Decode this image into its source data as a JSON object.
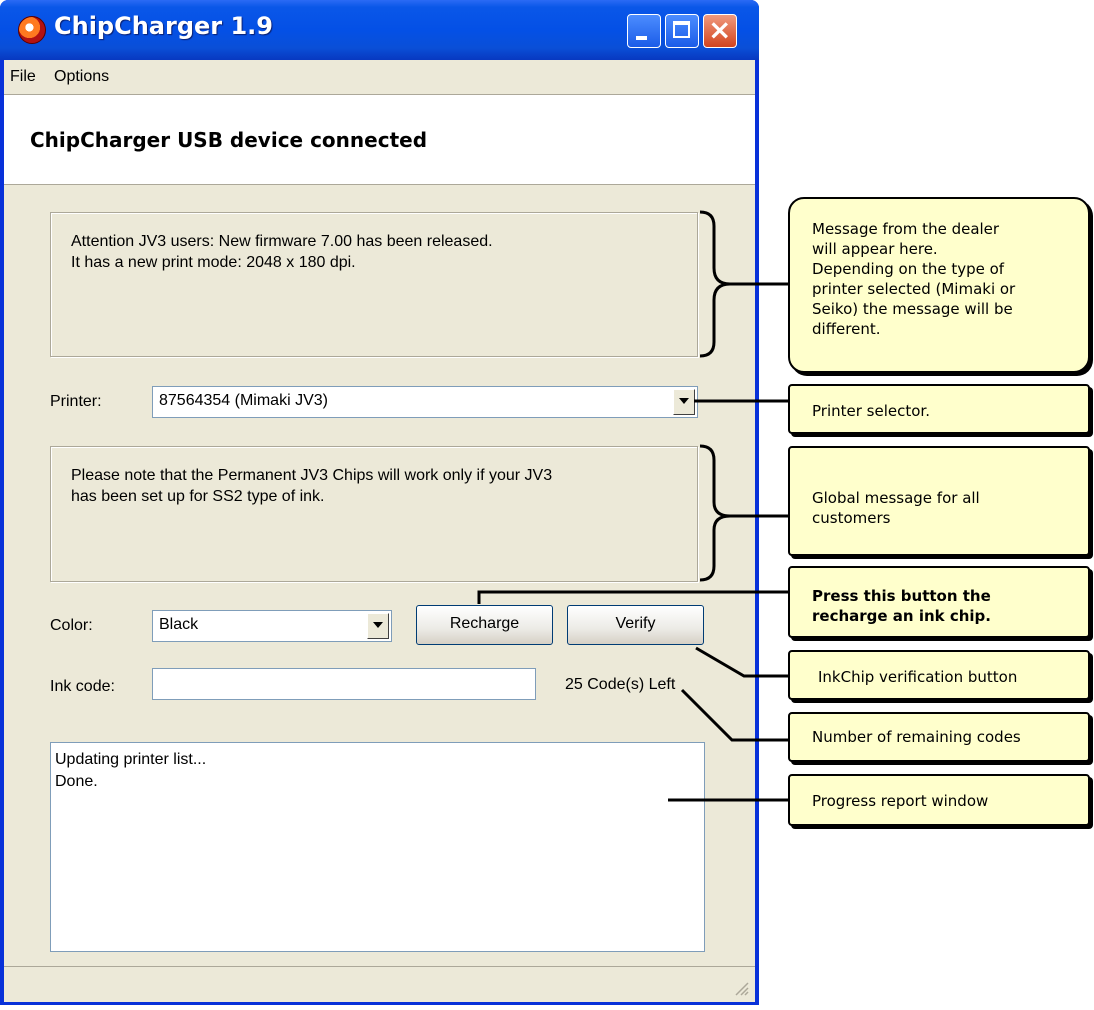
{
  "window": {
    "title": "ChipCharger 1.9",
    "buttons": {
      "minimize": "minimize",
      "maximize": "maximize",
      "close": "close"
    }
  },
  "menu": {
    "file": "File",
    "options": "Options"
  },
  "header": {
    "status": "ChipCharger USB device connected"
  },
  "dealer_message": {
    "lines": [
      "Attention JV3 users: New firmware 7.00 has been released.",
      "It has a new print mode: 2048 x 180 dpi."
    ]
  },
  "printer": {
    "label": "Printer:",
    "selected": "87564354 (Mimaki JV3)"
  },
  "global_message": {
    "lines": [
      "Please note that the Permanent JV3 Chips will work only if your JV3",
      "has been set up for SS2 type of ink."
    ]
  },
  "color": {
    "label": "Color:",
    "selected": "Black"
  },
  "buttons": {
    "recharge": "Recharge",
    "verify": "Verify"
  },
  "ink_code": {
    "label": "Ink code:",
    "value": "",
    "codes_left": "25 Code(s) Left"
  },
  "log": {
    "lines": [
      "Updating printer list...",
      "Done."
    ]
  },
  "callouts": {
    "dealer": [
      "Message from the dealer",
      "will appear here.",
      "Depending on the type of",
      "printer selected (Mimaki or",
      "Seiko) the message will be",
      "different."
    ],
    "printer_selector": "Printer selector.",
    "global": [
      "Global message for all",
      "customers"
    ],
    "recharge": [
      "Press this button the",
      "recharge an ink chip."
    ],
    "verify": "InkChip verification button",
    "codes": "Number of remaining codes",
    "progress": "Progress report window"
  },
  "colors": {
    "callout_bg": "#ffffcc",
    "window_face": "#ece9d8",
    "titlebar": "#0450e6"
  }
}
